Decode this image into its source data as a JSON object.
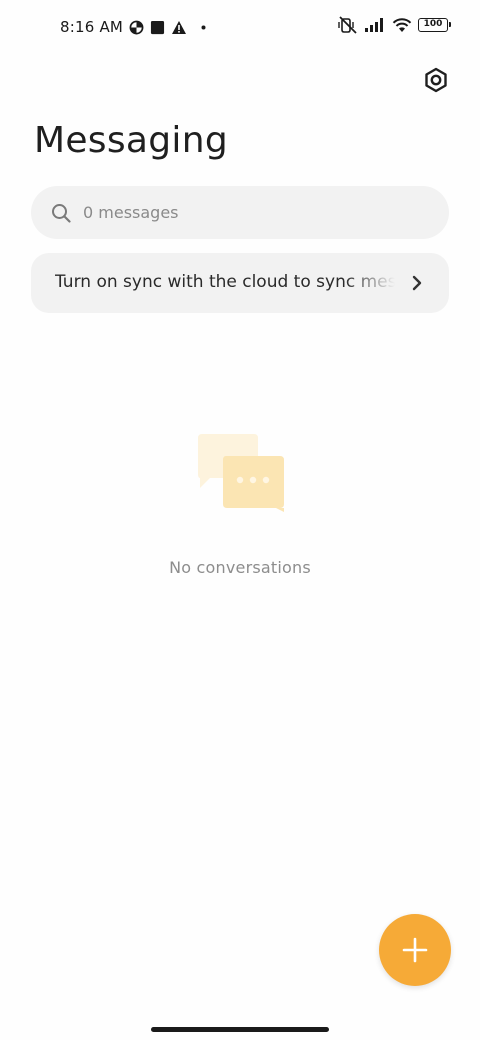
{
  "status_bar": {
    "time": "8:16 AM",
    "battery": "100",
    "icons": [
      "data-saver-icon",
      "square-notification-icon",
      "warning-icon",
      "dot-icon",
      "muted-vibrate-icon",
      "signal-icon",
      "wifi-icon",
      "battery-icon"
    ]
  },
  "header": {
    "title": "Messaging",
    "settings_icon": "settings-hexagon-icon"
  },
  "search": {
    "placeholder": "0 messages",
    "value": ""
  },
  "sync_banner": {
    "text": "Turn on sync with the cloud to sync messages"
  },
  "empty_state": {
    "illustration": "chat-bubbles-icon",
    "text": "No conversations"
  },
  "fab": {
    "icon": "plus-icon"
  },
  "colors": {
    "accent": "#f6aa37",
    "surface": "#f2f2f2",
    "background": "#fefefe",
    "illustration_light": "#fdf3dd",
    "illustration_dark": "#fbe5b3"
  }
}
